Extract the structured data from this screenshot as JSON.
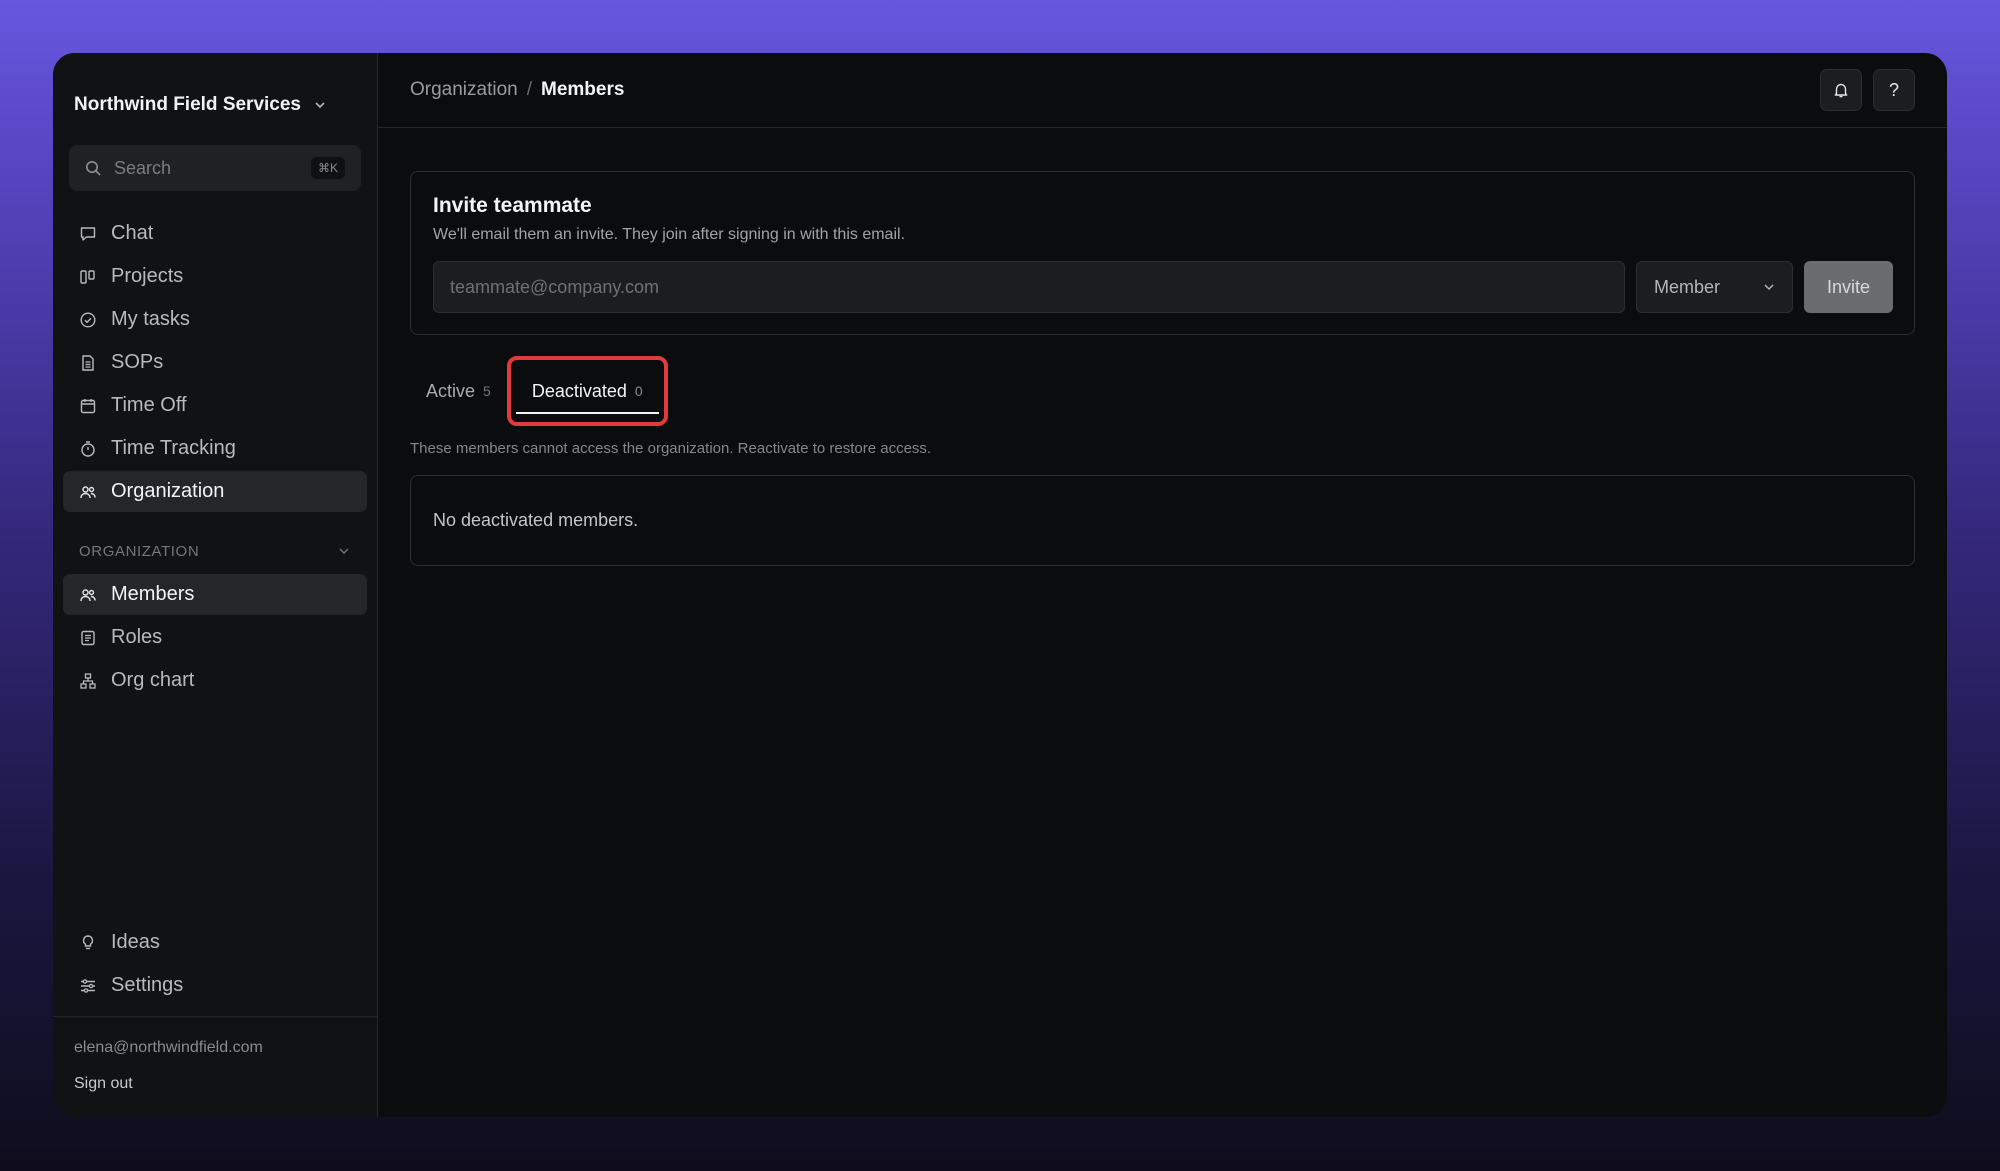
{
  "sidebar": {
    "org_name": "Northwind Field Services",
    "search": {
      "placeholder": "Search",
      "shortcut": "⌘K"
    },
    "nav": [
      {
        "label": "Chat",
        "icon": "chat-icon"
      },
      {
        "label": "Projects",
        "icon": "projects-icon"
      },
      {
        "label": "My tasks",
        "icon": "check-circle-icon"
      },
      {
        "label": "SOPs",
        "icon": "document-icon"
      },
      {
        "label": "Time Off",
        "icon": "calendar-icon"
      },
      {
        "label": "Time Tracking",
        "icon": "stopwatch-icon"
      },
      {
        "label": "Organization",
        "icon": "users-icon",
        "active": true
      }
    ],
    "section": {
      "title": "ORGANIZATION",
      "items": [
        {
          "label": "Members",
          "icon": "members-icon",
          "active": true
        },
        {
          "label": "Roles",
          "icon": "list-icon"
        },
        {
          "label": "Org chart",
          "icon": "org-chart-icon"
        }
      ]
    },
    "bottom_nav": [
      {
        "label": "Ideas",
        "icon": "lightbulb-icon"
      },
      {
        "label": "Settings",
        "icon": "sliders-icon"
      }
    ],
    "account": {
      "email": "elena@northwindfield.com",
      "sign_out": "Sign out"
    }
  },
  "header": {
    "breadcrumb": {
      "parent": "Organization",
      "separator": "/",
      "current": "Members"
    },
    "help_label": "?"
  },
  "invite": {
    "title": "Invite teammate",
    "subtitle": "We'll email them an invite. They join after signing in with this email.",
    "email_placeholder": "teammate@company.com",
    "email_value": "",
    "role_selected": "Member",
    "button_label": "Invite"
  },
  "tabs": [
    {
      "label": "Active",
      "count": "5"
    },
    {
      "label": "Deactivated",
      "count": "0",
      "active": true
    }
  ],
  "deactivated": {
    "hint": "These members cannot access the organization. Reactivate to restore access.",
    "empty_message": "No deactivated members."
  },
  "colors": {
    "accent_highlight": "#e13b3b",
    "background_gradient_top": "#6757dd",
    "app_background": "#0b0c0e"
  }
}
